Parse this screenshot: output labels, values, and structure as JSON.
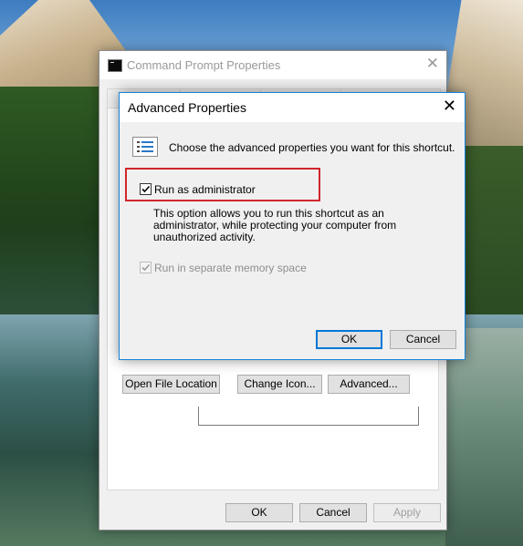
{
  "main_window": {
    "title": "Command Prompt Properties",
    "close_glyph": "✕",
    "buttons": {
      "open_file_location": "Open File Location",
      "change_icon": "Change Icon...",
      "advanced": "Advanced...",
      "ok": "OK",
      "cancel": "Cancel",
      "apply": "Apply"
    }
  },
  "dialog": {
    "title": "Advanced Properties",
    "close_glyph": "✕",
    "description": "Choose the advanced properties you want for this shortcut.",
    "run_as_admin": {
      "label": "Run as administrator",
      "checked": true
    },
    "info_lines": [
      "This option allows you to run this shortcut as an",
      "administrator, while protecting your computer from",
      "unauthorized activity."
    ],
    "separate_memory": {
      "label": "Run in separate memory space",
      "checked": true,
      "disabled": true
    },
    "buttons": {
      "ok": "OK",
      "cancel": "Cancel"
    }
  },
  "icons": {
    "main_title_icon": "command-prompt-icon",
    "dialog_icon": "properties-list-icon"
  },
  "colors": {
    "highlight_box": "#d1262a",
    "accent": "#0078d7"
  }
}
